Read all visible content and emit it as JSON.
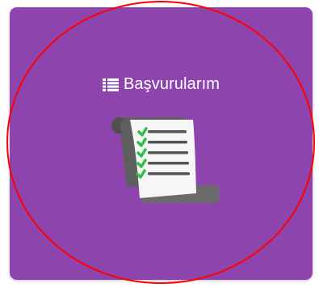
{
  "tile": {
    "title": "Başvurularım",
    "background_color": "#8e44ad",
    "icons": {
      "title_icon": "list-icon",
      "main_icon": "checklist-scroll-icon"
    }
  },
  "annotation": {
    "shape": "ellipse",
    "color": "#ff0000"
  }
}
